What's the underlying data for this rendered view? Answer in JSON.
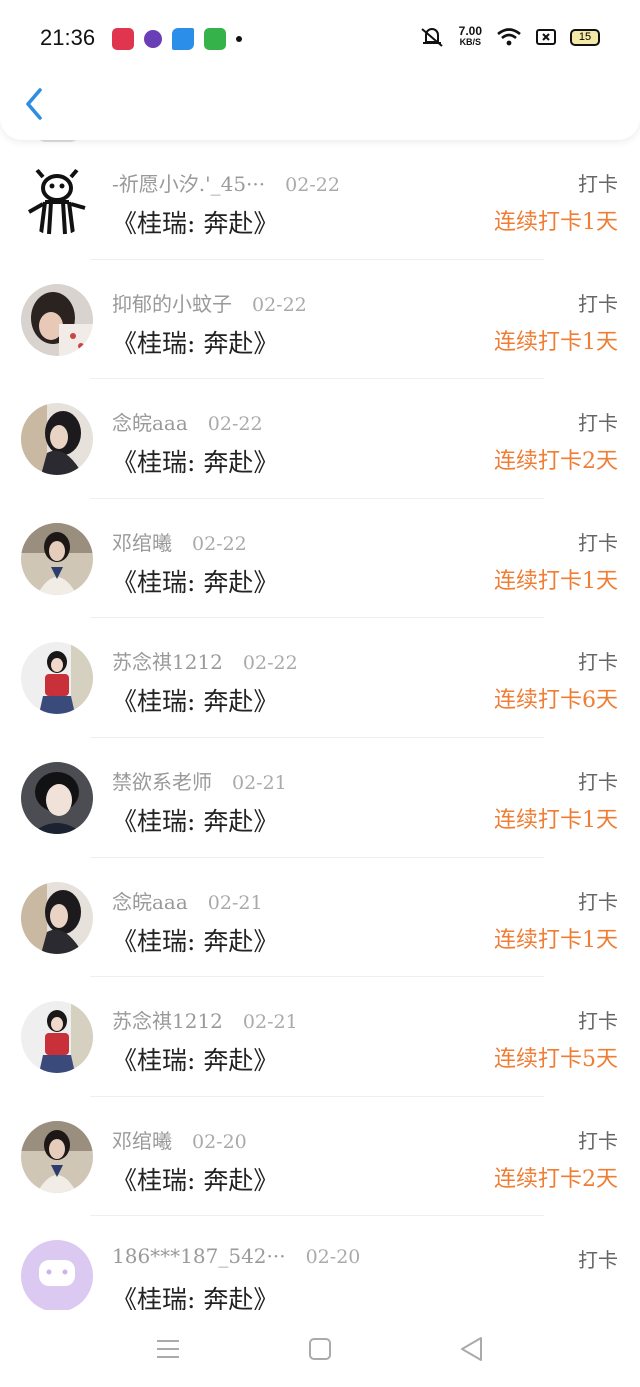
{
  "status_bar": {
    "time": "21:36",
    "net_speed": "7.00",
    "net_unit": "KB/S",
    "battery": "15",
    "app_icon_colors": [
      "#e0344f",
      "#6a3fb5",
      "#2b8ee8",
      "#35b34a"
    ]
  },
  "accent_color": "#ef7d34",
  "list": {
    "rows": [
      {
        "avatar": "doodle",
        "username": "-祈愿小汐.'_45···",
        "date": "02-22",
        "title": "《桂瑞: 奔赴》",
        "type": "打卡",
        "streak": "连续打卡1天"
      },
      {
        "avatar": "photo-girl-1",
        "username": "抑郁的小蚊子",
        "date": "02-22",
        "title": "《桂瑞: 奔赴》",
        "type": "打卡",
        "streak": "连续打卡1天"
      },
      {
        "avatar": "photo-girl-2",
        "username": "念皖aaa",
        "date": "02-22",
        "title": "《桂瑞: 奔赴》",
        "type": "打卡",
        "streak": "连续打卡2天"
      },
      {
        "avatar": "photo-girl-3",
        "username": "邓绾曦",
        "date": "02-22",
        "title": "《桂瑞: 奔赴》",
        "type": "打卡",
        "streak": "连续打卡1天"
      },
      {
        "avatar": "photo-girl-4",
        "username": "苏念祺1212",
        "date": "02-22",
        "title": "《桂瑞: 奔赴》",
        "type": "打卡",
        "streak": "连续打卡6天"
      },
      {
        "avatar": "photo-boy",
        "username": "禁欲系老师",
        "date": "02-21",
        "title": "《桂瑞: 奔赴》",
        "type": "打卡",
        "streak": "连续打卡1天"
      },
      {
        "avatar": "photo-girl-2",
        "username": "念皖aaa",
        "date": "02-21",
        "title": "《桂瑞: 奔赴》",
        "type": "打卡",
        "streak": "连续打卡1天"
      },
      {
        "avatar": "photo-girl-4",
        "username": "苏念祺1212",
        "date": "02-21",
        "title": "《桂瑞: 奔赴》",
        "type": "打卡",
        "streak": "连续打卡5天"
      },
      {
        "avatar": "photo-girl-3",
        "username": "邓绾曦",
        "date": "02-20",
        "title": "《桂瑞: 奔赴》",
        "type": "打卡",
        "streak": "连续打卡2天"
      },
      {
        "avatar": "default-purple",
        "username": "186***187_542···",
        "date": "02-20",
        "title": "《桂瑞: 奔赴》",
        "type": "打卡",
        "streak": ""
      }
    ]
  },
  "nav": {
    "icons": [
      "menu-icon",
      "home-square-icon",
      "back-triangle-icon"
    ]
  }
}
